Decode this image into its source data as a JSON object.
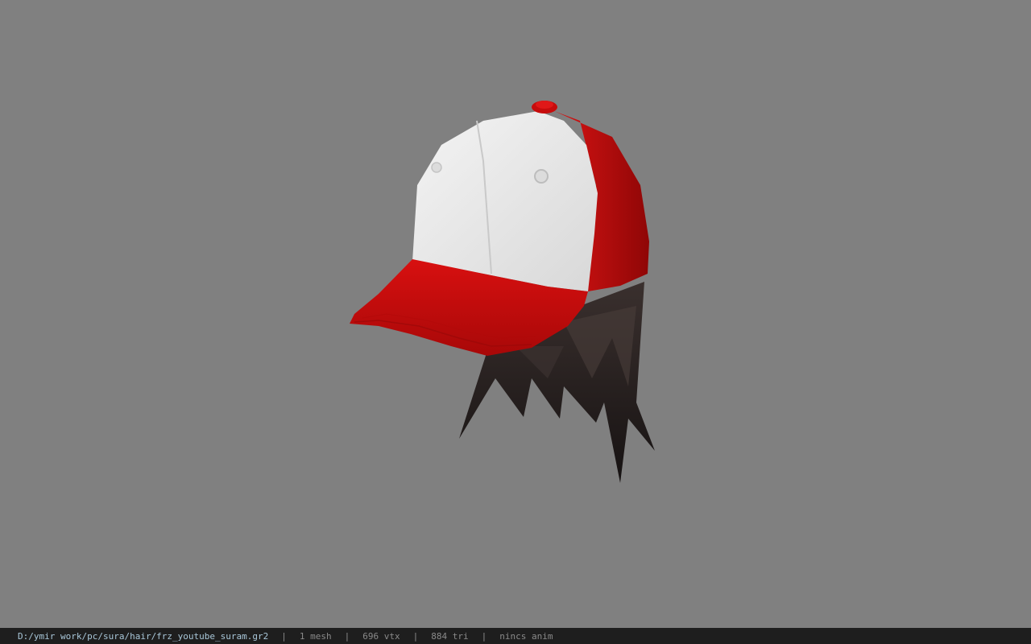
{
  "window": {
    "background_color": "#808080"
  },
  "viewport": {
    "model_name": "baseball-cap-hair-model",
    "colors": {
      "cap_red": "#c20a0a",
      "cap_white": "#ececec",
      "hair": "#2a2423"
    }
  },
  "statusbar": {
    "file_path": "D:/ymir work/pc/sura/hair/frz_youtube_suram.gr2",
    "separator": "|",
    "mesh_count": "1 mesh",
    "vertex_count": "696 vtx",
    "triangle_count": "884 tri",
    "anim_status": "nincs anim"
  }
}
